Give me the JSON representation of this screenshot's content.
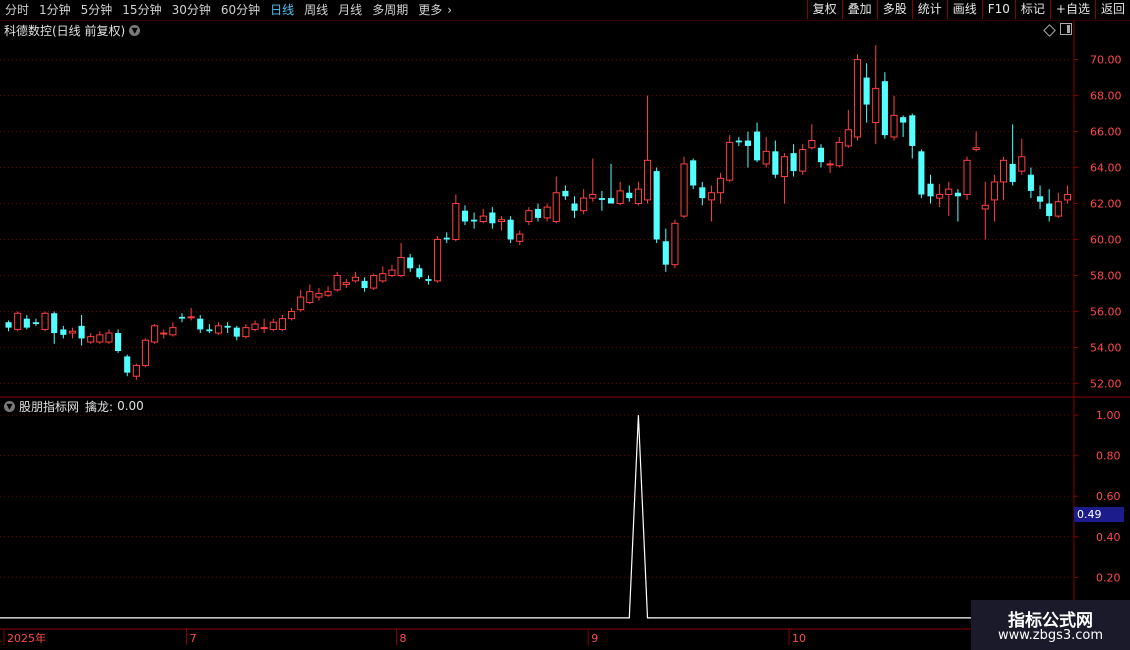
{
  "toolbar": {
    "periods": [
      "分时",
      "1分钟",
      "5分钟",
      "15分钟",
      "30分钟",
      "60分钟",
      "日线",
      "周线",
      "月线",
      "多周期",
      "更多"
    ],
    "active_period": "日线",
    "right_buttons": [
      "复权",
      "叠加",
      "多股",
      "统计",
      "画线",
      "F10",
      "标记",
      "+自选",
      "返回"
    ]
  },
  "main_chart": {
    "title": "科德数控(日线 前复权)"
  },
  "indicator": {
    "name": "股朋指标网",
    "label": "擒龙:",
    "value": "0.00",
    "current_tag": "0.49"
  },
  "watermark": {
    "title": "指标公式网",
    "url": "www.zbgs3.com"
  },
  "colors": {
    "up": "#ff4040",
    "down": "#54ffff",
    "grid": "#6e0000",
    "axis_text": "#ff4a4a",
    "indicator_line": "#ffffff"
  },
  "chart_data": [
    {
      "type": "candlestick",
      "y_ticks": [
        "70.00",
        "68.00",
        "66.00",
        "64.00",
        "62.00",
        "60.00",
        "58.00",
        "56.00",
        "54.00",
        "52.00"
      ],
      "ylim": [
        51.3,
        71.2
      ],
      "x_labels": [
        {
          "label": "2025年",
          "index": 0
        },
        {
          "label": "7",
          "index": 20
        },
        {
          "label": "8",
          "index": 43
        },
        {
          "label": "9",
          "index": 64
        },
        {
          "label": "10",
          "index": 86
        }
      ],
      "candles": [
        [
          55.4,
          55.1,
          55.5,
          54.9
        ],
        [
          55.0,
          55.9,
          56.0,
          54.9
        ],
        [
          55.6,
          55.1,
          55.8,
          55.0
        ],
        [
          55.4,
          55.3,
          55.6,
          55.2
        ],
        [
          55.0,
          55.9,
          56.0,
          54.9
        ],
        [
          55.9,
          54.8,
          56.0,
          54.2
        ],
        [
          55.0,
          54.7,
          55.2,
          54.5
        ],
        [
          54.8,
          54.9,
          55.1,
          54.5
        ],
        [
          55.2,
          54.5,
          55.8,
          54.1
        ],
        [
          54.3,
          54.6,
          54.8,
          54.2
        ],
        [
          54.3,
          54.7,
          54.9,
          54.2
        ],
        [
          54.3,
          54.8,
          55.0,
          54.2
        ],
        [
          54.8,
          53.8,
          55.0,
          53.7
        ],
        [
          53.5,
          52.6,
          53.6,
          52.4
        ],
        [
          52.4,
          53.0,
          53.1,
          52.2
        ],
        [
          53.0,
          54.4,
          54.5,
          52.9
        ],
        [
          54.3,
          55.2,
          55.3,
          54.2
        ],
        [
          54.8,
          54.8,
          55.0,
          54.5
        ],
        [
          54.7,
          55.1,
          55.4,
          54.6
        ],
        [
          55.7,
          55.6,
          55.9,
          55.4
        ],
        [
          55.7,
          55.7,
          56.2,
          55.5
        ],
        [
          55.6,
          55.0,
          55.8,
          54.8
        ],
        [
          55.0,
          54.9,
          55.3,
          54.8
        ],
        [
          54.8,
          55.2,
          55.4,
          54.7
        ],
        [
          55.2,
          55.1,
          55.4,
          54.8
        ],
        [
          55.1,
          54.6,
          55.2,
          54.4
        ],
        [
          54.6,
          55.1,
          55.3,
          54.5
        ],
        [
          55.0,
          55.3,
          55.5,
          54.9
        ],
        [
          55.1,
          55.1,
          55.6,
          54.8
        ],
        [
          55.0,
          55.4,
          55.6,
          54.9
        ],
        [
          55.0,
          55.6,
          55.8,
          54.9
        ],
        [
          55.6,
          56.0,
          56.2,
          55.5
        ],
        [
          56.1,
          56.8,
          57.2,
          56.0
        ],
        [
          56.5,
          57.1,
          57.5,
          56.4
        ],
        [
          56.8,
          57.0,
          57.3,
          56.6
        ],
        [
          56.9,
          57.1,
          57.4,
          56.8
        ],
        [
          57.2,
          58.0,
          58.2,
          57.1
        ],
        [
          57.5,
          57.6,
          57.8,
          57.3
        ],
        [
          57.7,
          57.9,
          58.2,
          57.6
        ],
        [
          57.7,
          57.3,
          57.9,
          57.1
        ],
        [
          57.3,
          58.0,
          58.1,
          57.2
        ],
        [
          57.7,
          58.1,
          58.5,
          57.6
        ],
        [
          58.0,
          58.3,
          58.6,
          57.9
        ],
        [
          58.0,
          59.0,
          59.8,
          57.9
        ],
        [
          59.0,
          58.4,
          59.2,
          58.2
        ],
        [
          58.4,
          57.9,
          58.6,
          57.8
        ],
        [
          57.8,
          57.7,
          58.0,
          57.5
        ],
        [
          57.7,
          60.0,
          60.2,
          57.6
        ],
        [
          60.1,
          60.0,
          60.4,
          59.8
        ],
        [
          60.0,
          62.0,
          62.5,
          59.9
        ],
        [
          61.6,
          61.0,
          61.9,
          60.8
        ],
        [
          61.1,
          61.0,
          61.5,
          60.6
        ],
        [
          61.0,
          61.3,
          61.7,
          60.9
        ],
        [
          61.5,
          60.9,
          61.8,
          60.6
        ],
        [
          61.0,
          61.1,
          61.3,
          60.5
        ],
        [
          61.1,
          60.0,
          61.3,
          59.8
        ],
        [
          59.9,
          60.3,
          60.5,
          59.7
        ],
        [
          61.0,
          61.6,
          61.8,
          60.8
        ],
        [
          61.7,
          61.2,
          62.0,
          61.0
        ],
        [
          61.2,
          61.8,
          62.0,
          61.0
        ],
        [
          61.0,
          62.6,
          63.5,
          60.9
        ],
        [
          62.7,
          62.4,
          63.0,
          62.2
        ],
        [
          62.0,
          61.6,
          62.4,
          61.2
        ],
        [
          61.6,
          62.3,
          62.8,
          61.4
        ],
        [
          62.3,
          62.5,
          64.5,
          62.1
        ],
        [
          62.3,
          62.2,
          62.7,
          61.6
        ],
        [
          62.3,
          62.0,
          64.2,
          62.0
        ],
        [
          62.0,
          62.7,
          63.2,
          61.9
        ],
        [
          62.6,
          62.3,
          63.0,
          62.1
        ],
        [
          62.0,
          62.8,
          63.2,
          61.9
        ],
        [
          62.2,
          64.4,
          68.0,
          62.0
        ],
        [
          63.8,
          60.0,
          64.0,
          59.8
        ],
        [
          59.9,
          58.6,
          60.6,
          58.2
        ],
        [
          58.6,
          60.9,
          61.1,
          58.4
        ],
        [
          61.3,
          64.2,
          64.6,
          61.2
        ],
        [
          64.4,
          63.0,
          64.5,
          62.8
        ],
        [
          62.9,
          62.3,
          63.2,
          61.9
        ],
        [
          62.2,
          62.6,
          63.0,
          61.0
        ],
        [
          62.6,
          63.4,
          63.7,
          62.0
        ],
        [
          63.3,
          65.4,
          65.8,
          63.2
        ],
        [
          65.5,
          65.4,
          65.7,
          65.2
        ],
        [
          65.5,
          65.2,
          66.0,
          64.0
        ],
        [
          66.0,
          64.4,
          66.5,
          64.3
        ],
        [
          64.2,
          64.9,
          65.7,
          64.0
        ],
        [
          64.9,
          63.6,
          65.5,
          63.4
        ],
        [
          63.5,
          64.6,
          64.8,
          62.0
        ],
        [
          64.8,
          63.8,
          65.3,
          63.5
        ],
        [
          63.8,
          65.0,
          65.3,
          63.6
        ],
        [
          65.1,
          65.5,
          66.4,
          65.0
        ],
        [
          65.1,
          64.3,
          65.3,
          64.0
        ],
        [
          64.2,
          64.2,
          64.4,
          63.7
        ],
        [
          64.1,
          65.4,
          65.7,
          64.0
        ],
        [
          65.2,
          66.1,
          67.2,
          65.1
        ],
        [
          65.7,
          70.0,
          70.3,
          65.5
        ],
        [
          69.0,
          67.5,
          69.8,
          66.5
        ],
        [
          66.5,
          68.4,
          70.8,
          65.3
        ],
        [
          68.8,
          65.8,
          69.3,
          65.6
        ],
        [
          65.7,
          66.9,
          68.0,
          65.5
        ],
        [
          66.8,
          66.5,
          66.9,
          65.7
        ],
        [
          66.9,
          65.2,
          67.0,
          64.5
        ],
        [
          64.9,
          62.5,
          65.0,
          62.3
        ],
        [
          63.1,
          62.4,
          63.6,
          62.0
        ],
        [
          62.3,
          62.5,
          63.1,
          61.8
        ],
        [
          62.5,
          62.8,
          63.2,
          61.3
        ],
        [
          62.6,
          62.4,
          62.8,
          61.0
        ],
        [
          62.5,
          64.4,
          64.6,
          62.2
        ],
        [
          65.0,
          65.1,
          66.0,
          64.9
        ],
        [
          61.7,
          61.9,
          63.2,
          60.0
        ],
        [
          62.2,
          63.2,
          63.6,
          61.0
        ],
        [
          63.2,
          64.4,
          64.6,
          62.2
        ],
        [
          64.2,
          63.2,
          66.4,
          63.0
        ],
        [
          63.8,
          64.6,
          65.6,
          63.6
        ],
        [
          63.6,
          62.7,
          64.0,
          62.3
        ],
        [
          62.4,
          62.1,
          63.0,
          61.7
        ],
        [
          62.0,
          61.3,
          62.8,
          61.0
        ],
        [
          61.3,
          62.1,
          62.6,
          61.2
        ],
        [
          62.2,
          62.5,
          63.0,
          62.0
        ]
      ]
    },
    {
      "type": "line",
      "series": [
        {
          "values": [
            0,
            0,
            0,
            0,
            0,
            0,
            0,
            0,
            0,
            0,
            0,
            0,
            0,
            0,
            0,
            0,
            0,
            0,
            0,
            0,
            0,
            0,
            0,
            0,
            0,
            0,
            0,
            0,
            0,
            0,
            0,
            0,
            0,
            0,
            0,
            0,
            0,
            0,
            0,
            0,
            0,
            0,
            0,
            0,
            0,
            0,
            0,
            0,
            0,
            0,
            0,
            0,
            0,
            0,
            0,
            0,
            0,
            0,
            0,
            0,
            0,
            0,
            0,
            0,
            0,
            0,
            0,
            0,
            0,
            1,
            0,
            0,
            0,
            0,
            0,
            0,
            0,
            0,
            0,
            0,
            0,
            0,
            0,
            0,
            0,
            0,
            0,
            0,
            0,
            0,
            0,
            0,
            0,
            0,
            0,
            0,
            0,
            0,
            0,
            0,
            0,
            0,
            0,
            0,
            0,
            0,
            0,
            0,
            0,
            0,
            0,
            0,
            0,
            0,
            0,
            0,
            0,
            0,
            0,
            0,
            0
          ]
        }
      ],
      "y_ticks": [
        "1.00",
        "0.80",
        "0.60",
        "0.40",
        "0.20"
      ],
      "ylim": [
        -0.05,
        1.05
      ]
    }
  ]
}
